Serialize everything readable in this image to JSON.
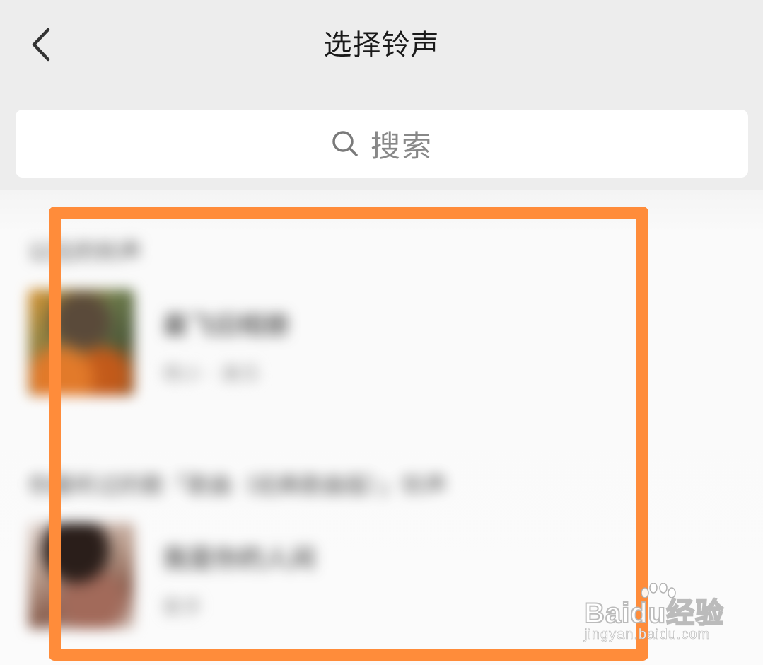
{
  "nav": {
    "back_icon": "chevron-left-icon",
    "title": "选择铃声"
  },
  "search": {
    "icon": "search-icon",
    "placeholder": "搜索"
  },
  "sections": [
    {
      "header": "以往的铃声",
      "items": [
        {
          "title": "最飞旧相册",
          "subtitle": "杨小 · 美乐"
        }
      ]
    },
    {
      "header": "你最听过的歌「歌曲（经典歌曲版）」铃声",
      "items": [
        {
          "title": "我是你的人间",
          "subtitle": "歌手"
        }
      ]
    }
  ],
  "overlay": {
    "highlight_color": "#ff8c3a"
  },
  "watermark": {
    "logo": "Baidu经验",
    "url": "jingyan.baidu.com"
  },
  "colors": {
    "nav_bg": "#ededed",
    "content_bg": "#fafafa",
    "title_text": "#1a1a1a",
    "placeholder_text": "#888888"
  }
}
